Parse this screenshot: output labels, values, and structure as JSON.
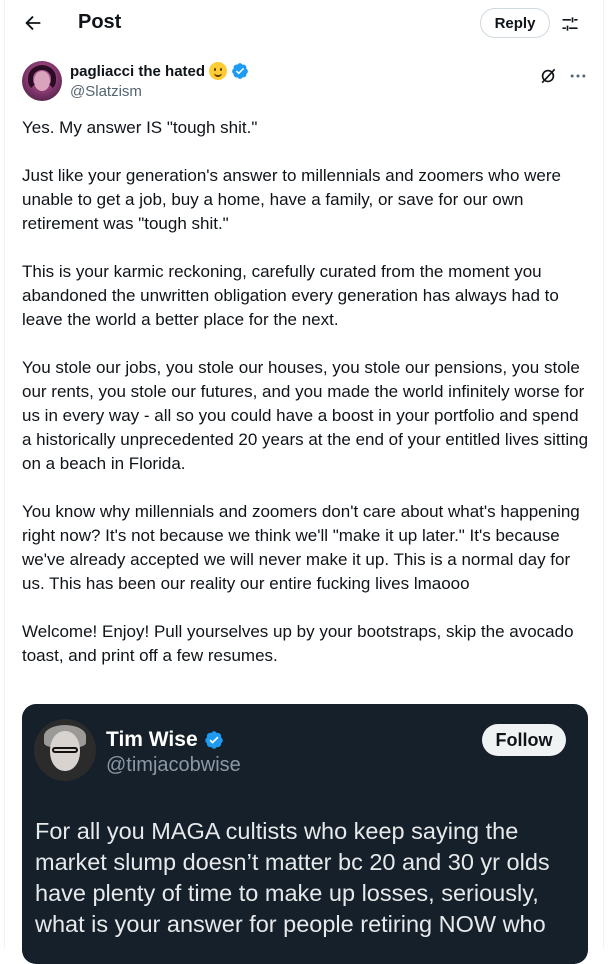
{
  "header": {
    "title": "Post",
    "reply_label": "Reply"
  },
  "post": {
    "author_name": "pagliacci the hated",
    "author_handle": "@Slatzism",
    "paragraphs": [
      "Yes. My answer IS \"tough shit.\"",
      "Just like your generation's answer to millennials and zoomers who were unable to get a job, buy a home, have a family, or save for our own retirement was \"tough shit.\"",
      "This is your karmic reckoning, carefully curated from the moment you abandoned the unwritten obligation every generation has always had to leave the world a better place for the next.",
      "You stole our jobs, you stole our houses, you stole our pensions, you stole our rents, you stole our futures, and you made the world infinitely worse for us in every way - all so you could have a boost in your portfolio and spend a historically unprecedented 20 years at the end of your entitled lives sitting on a beach in Florida.",
      "You know why millennials and zoomers don't care about what's happening right now? It's not because we think we'll \"make it up later.\" It's because we've already accepted we will never make it up. This is a normal day for us. This has been our reality our entire fucking lives lmaooo",
      "Welcome! Enjoy! Pull yourselves up by your bootstraps, skip the avocado toast, and print off a few resumes."
    ]
  },
  "quoted": {
    "author_name": "Tim Wise",
    "author_handle": "@timjacobwise",
    "follow_label": "Follow",
    "text": "For all you MAGA cultists who keep saying the market slump doesn’t matter bc 20 and 30 yr olds have plenty of time to make up losses, seriously, what is your answer for people retiring NOW who"
  },
  "icons": {
    "back": "arrow-left-icon",
    "tune": "sliders-icon",
    "grok": "grok-icon",
    "more": "more-dots-icon",
    "verified": "verified-badge-icon",
    "emoji": "slightly-smiling-face-emoji"
  },
  "colors": {
    "verified_blue": "#1d9bf0",
    "text": "#0f1419",
    "secondary_text": "#536471",
    "embed_bg": "#15202b"
  }
}
